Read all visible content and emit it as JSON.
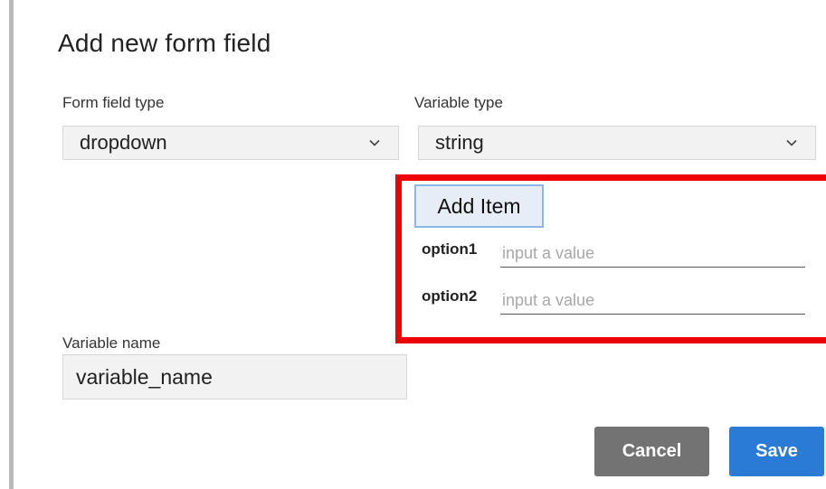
{
  "dialog": {
    "title": "Add new form field"
  },
  "form_field_type": {
    "label": "Form field type",
    "value": "dropdown"
  },
  "variable_type": {
    "label": "Variable type",
    "value": "string"
  },
  "options_panel": {
    "add_item_label": "Add Item",
    "options": [
      {
        "label": "option1",
        "placeholder": "input a value",
        "value": ""
      },
      {
        "label": "option2",
        "placeholder": "input a value",
        "value": ""
      }
    ],
    "highlight_color": "#ee0000"
  },
  "variable_name": {
    "label": "Variable name",
    "value": "variable_name"
  },
  "actions": {
    "cancel_label": "Cancel",
    "save_label": "Save"
  },
  "colors": {
    "save_button": "#2a7bd6",
    "cancel_button": "#737373"
  },
  "icons": {
    "select_arrow": "chevron-down-icon"
  }
}
